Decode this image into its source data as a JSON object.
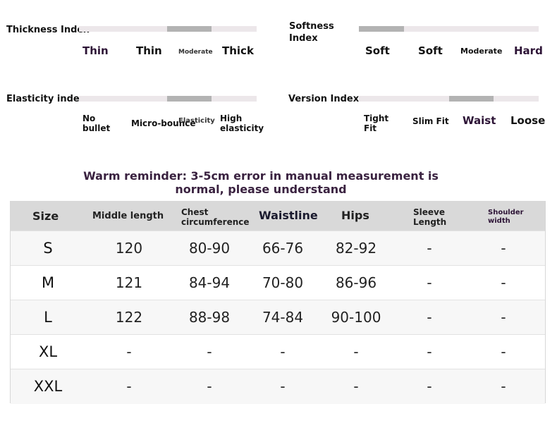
{
  "indices": {
    "thickness": {
      "label": "Thickness Index",
      "options": [
        "Thin",
        "Thin",
        "Moderate",
        "Thick"
      ],
      "selected": "Moderate"
    },
    "softness": {
      "label": "Softness Index",
      "options": [
        "Soft",
        "Soft",
        "Moderate",
        "Hard"
      ],
      "selected": "Soft"
    },
    "elasticity": {
      "label": "Elasticity index",
      "options": [
        "No bullet",
        "Micro-bounce",
        "Elasticity",
        "High elasticity"
      ],
      "selected": "Elasticity"
    },
    "version": {
      "label": "Version Index",
      "options": [
        "Tight Fit",
        "Slim Fit",
        "Waist",
        "Loose"
      ],
      "selected": "Waist"
    }
  },
  "reminder": "Warm reminder: 3-5cm error in manual measurement is normal, please understand",
  "size_table": {
    "headers": [
      "Size",
      "Middle length",
      "Chest circumference",
      "Waistline",
      "Hips",
      "Sleeve Length",
      "Shoulder width"
    ],
    "rows": [
      [
        "S",
        "120",
        "80-90",
        "66-76",
        "82-92",
        "-",
        "-"
      ],
      [
        "M",
        "121",
        "84-94",
        "70-80",
        "86-96",
        "-",
        "-"
      ],
      [
        "L",
        "122",
        "88-98",
        "74-84",
        "90-100",
        "-",
        "-"
      ],
      [
        "XL",
        "-",
        "-",
        "-",
        "-",
        "-",
        "-"
      ],
      [
        "XXL",
        "-",
        "-",
        "-",
        "-",
        "-",
        "-"
      ]
    ]
  },
  "colors": {
    "highlight_text": "#2d1436",
    "bar_track": "#ece7ea",
    "bar_fill": "#b3b3b3",
    "header_bg": "#d9d9d9"
  }
}
